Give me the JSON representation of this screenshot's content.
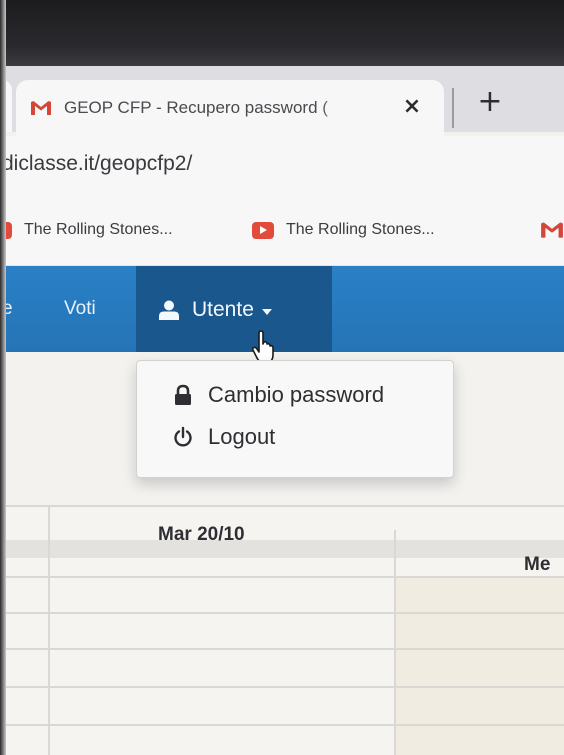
{
  "browser": {
    "tab_title": "GEOP CFP - Recupero password (",
    "tab_close": "×",
    "new_tab": "+",
    "url": "diclasse.it/geopcfp2/",
    "bookmarks": [
      {
        "label": "The Rolling Stones...",
        "icon": "youtube-icon"
      },
      {
        "label": "The Rolling Stones...",
        "icon": "youtube-icon"
      }
    ],
    "colors": {
      "gmail_red": "#d44638",
      "youtube_red": "#e24a3b"
    }
  },
  "navbar": {
    "partial_item": "e",
    "voti_label": "Voti",
    "user_label": "Utente",
    "color": "#2a80c6",
    "active_color": "#19578d"
  },
  "dropdown": {
    "items": [
      {
        "label": "Cambio password",
        "icon": "lock-icon"
      },
      {
        "label": "Logout",
        "icon": "power-icon"
      }
    ]
  },
  "table": {
    "columns": [
      "Mar 20/10",
      "Me"
    ]
  }
}
